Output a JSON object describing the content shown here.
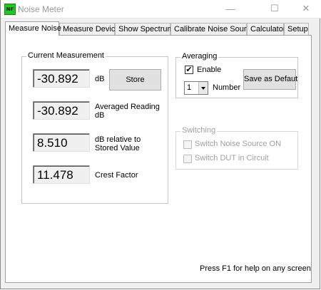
{
  "window": {
    "title": "Noise Meter",
    "icon_text": "NF",
    "icon_color": "#22c522",
    "controls": {
      "minimize": "—",
      "maximize": "☐",
      "close": "✕"
    }
  },
  "tabs": [
    {
      "label": "Measure Noise",
      "active": true
    },
    {
      "label": "Measure Device",
      "active": false
    },
    {
      "label": "Show Spectrum",
      "active": false
    },
    {
      "label": "Calibrate Noise Source",
      "active": false
    },
    {
      "label": "Calculator",
      "active": false
    },
    {
      "label": "Setup",
      "active": false
    }
  ],
  "current_measurement": {
    "group_label": "Current Measurement",
    "readouts": [
      {
        "value": "-30.892",
        "label": "dB"
      },
      {
        "value": "-30.892",
        "label": "Averaged Reading dB"
      },
      {
        "value": "8.510",
        "label": "dB relative to Stored Value"
      },
      {
        "value": "11.478",
        "label": "Crest Factor"
      }
    ],
    "store_button": "Store"
  },
  "averaging": {
    "group_label": "Averaging",
    "enable_label": "Enable",
    "enable_checked": true,
    "check_mark": "✔",
    "number_value": "1",
    "number_label": "Number",
    "save_default_button": "Save as Defaut"
  },
  "switching": {
    "group_label": "Switching",
    "options": [
      {
        "label": "Switch Noise Source ON",
        "checked": false
      },
      {
        "label": "Switch DUT in Circuit",
        "checked": false
      }
    ]
  },
  "help_text": "Press F1 for help on any screen"
}
